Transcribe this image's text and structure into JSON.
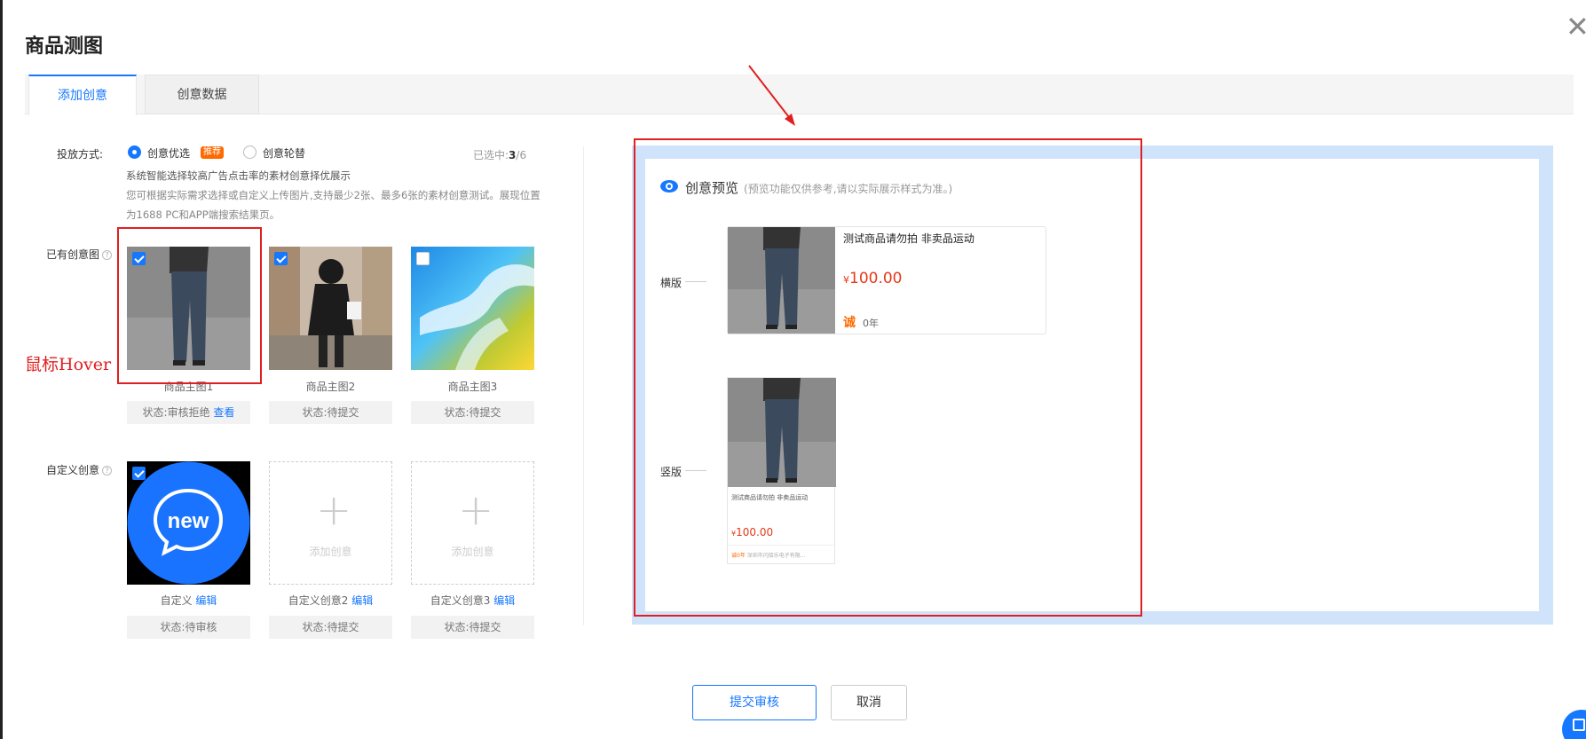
{
  "page": {
    "title": "商品测图",
    "close_icon": "close-icon"
  },
  "tabs": [
    {
      "label": "添加创意",
      "active": true
    },
    {
      "label": "创意数据",
      "active": false
    }
  ],
  "delivery": {
    "label": "投放方式:",
    "options": [
      {
        "label": "创意优选",
        "selected": true,
        "tag": "推荐"
      },
      {
        "label": "创意轮替",
        "selected": false
      }
    ],
    "selected_count_prefix": "已选中:",
    "selected_count_value": "3",
    "selected_count_total": "/6",
    "note_line1": "系统智能选择较高广告点击率的素材创意择优展示",
    "note_line2": "您可根据实际需求选择或自定义上传图片,支持最少2张、最多6张的素材创意测试。展现位置为1688 PC和APP端搜索结果页。"
  },
  "existing": {
    "label": "已有创意图",
    "help_icon": "?",
    "items": [
      {
        "caption": "商品主图1",
        "status": "状态:审核拒绝",
        "status_link": "查看",
        "checked": true
      },
      {
        "caption": "商品主图2",
        "status": "状态:待提交",
        "checked": true
      },
      {
        "caption": "商品主图3",
        "status": "状态:待提交",
        "checked": false
      }
    ]
  },
  "custom": {
    "label": "自定义创意",
    "help_icon": "?",
    "items": [
      {
        "caption": "自定义",
        "edit": "编辑",
        "status": "状态:待审核",
        "checked": true,
        "badge_text": "new"
      },
      {
        "caption": "自定义创意2",
        "edit": "编辑",
        "status": "状态:待提交",
        "add_text": "添加创意",
        "plus": "+"
      },
      {
        "caption": "自定义创意3",
        "edit": "编辑",
        "status": "状态:待提交",
        "add_text": "添加创意",
        "plus": "+"
      }
    ]
  },
  "annotation": {
    "text": "鼠标Hover",
    "color": "#e02020"
  },
  "preview": {
    "title": "创意预览",
    "subtitle": "(预览功能仅供参考,请以实际展示样式为准。)",
    "horizontal": {
      "label": "横版",
      "product_title": "测试商品请勿拍 非卖品运动",
      "currency": "¥",
      "price": "100.00",
      "cheng": "诚",
      "years": "0年"
    },
    "vertical": {
      "label": "竖版",
      "product_title": "测试商品请勿拍 非卖品运动",
      "currency": "¥",
      "price": "100.00",
      "cheng": "诚0年",
      "company": "深圳市闪接乐电子有限..."
    }
  },
  "footer": {
    "submit": "提交审核",
    "cancel": "取消"
  },
  "colors": {
    "accent": "#1677ff",
    "price": "#e8381b",
    "tag": "#ff6a00",
    "annotation": "#e02020",
    "preview_frame": "#cfe3fb"
  }
}
